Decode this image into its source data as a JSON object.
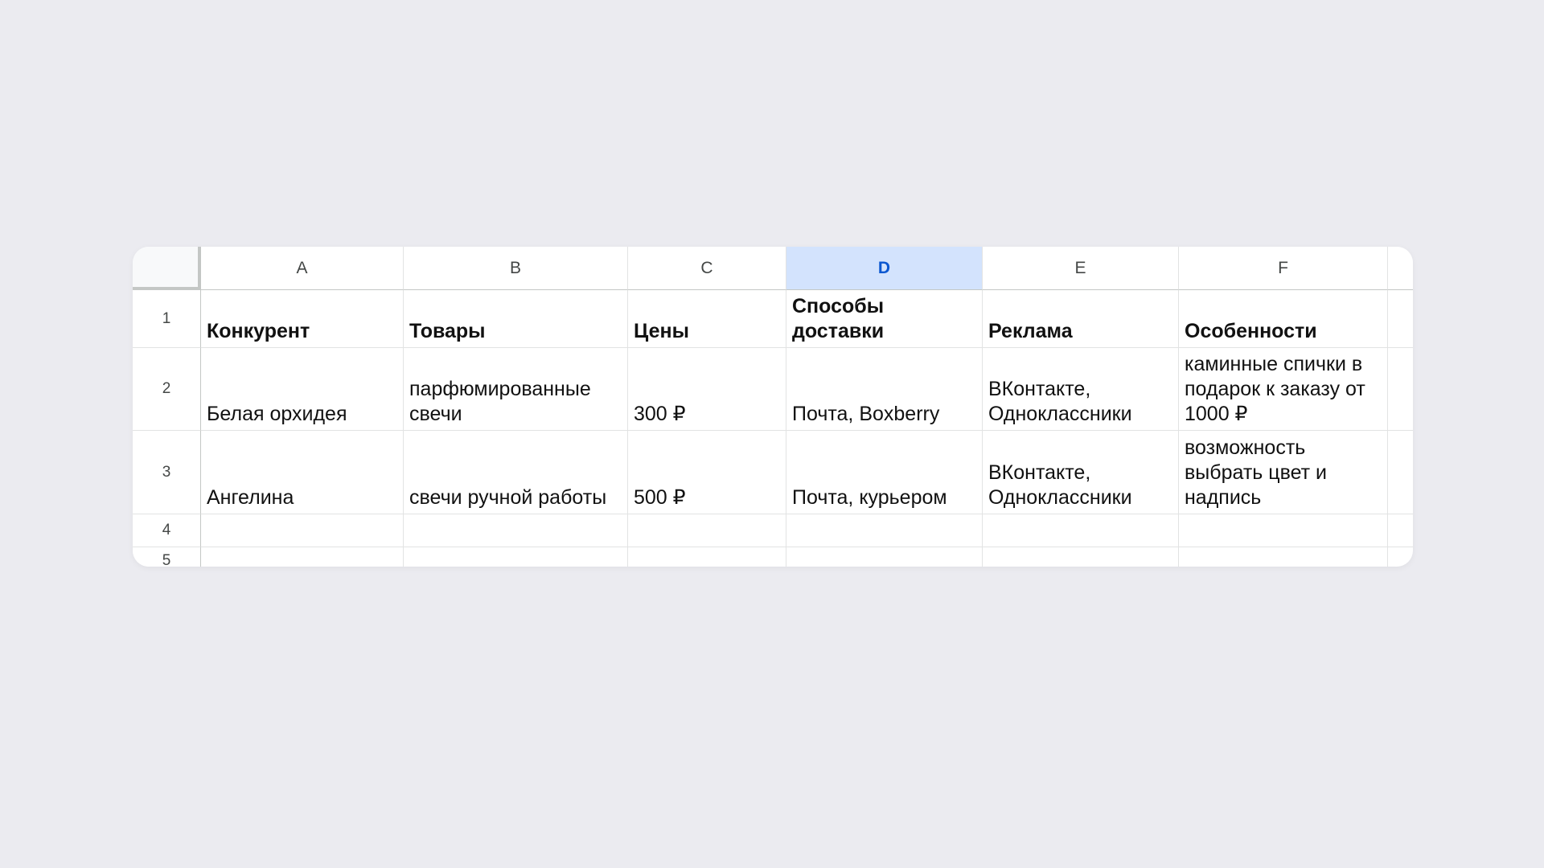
{
  "colors": {
    "background": "#EBEBF0",
    "sheet": "#FFFFFF",
    "gridline": "#E2E3E3",
    "selected_header_bg": "#D3E3FD",
    "selected_header_text": "#0B57D0"
  },
  "columns": [
    "A",
    "B",
    "C",
    "D",
    "E",
    "F"
  ],
  "selected_column": "D",
  "rows": [
    "1",
    "2",
    "3",
    "4",
    "5"
  ],
  "table": {
    "headers": [
      "Конкурент",
      "Товары",
      "Цены",
      "Способы доставки",
      "Реклама",
      "Особенности"
    ],
    "rows": [
      [
        "Белая орхидея",
        "парфюмированные свечи",
        "300 ₽",
        "Почта, Boxberry",
        "ВКонтакте, Одноклассники",
        "каминные спички в подарок к заказу от 1000 ₽"
      ],
      [
        "Ангелина",
        "свечи ручной работы",
        "500 ₽",
        "Почта, курьером",
        "ВКонтакте, Одноклассники",
        "возможность выбрать цвет и надпись"
      ]
    ]
  }
}
